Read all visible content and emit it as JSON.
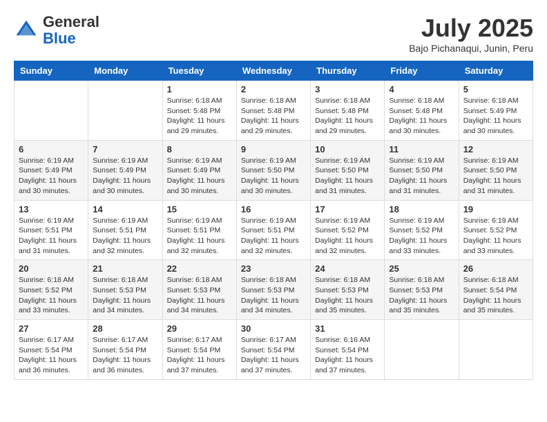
{
  "header": {
    "logo_general": "General",
    "logo_blue": "Blue",
    "month_title": "July 2025",
    "subtitle": "Bajo Pichanaqui, Junin, Peru"
  },
  "weekdays": [
    "Sunday",
    "Monday",
    "Tuesday",
    "Wednesday",
    "Thursday",
    "Friday",
    "Saturday"
  ],
  "weeks": [
    [
      {
        "day": "",
        "info": ""
      },
      {
        "day": "",
        "info": ""
      },
      {
        "day": "1",
        "info": "Sunrise: 6:18 AM\nSunset: 5:48 PM\nDaylight: 11 hours and 29 minutes."
      },
      {
        "day": "2",
        "info": "Sunrise: 6:18 AM\nSunset: 5:48 PM\nDaylight: 11 hours and 29 minutes."
      },
      {
        "day": "3",
        "info": "Sunrise: 6:18 AM\nSunset: 5:48 PM\nDaylight: 11 hours and 29 minutes."
      },
      {
        "day": "4",
        "info": "Sunrise: 6:18 AM\nSunset: 5:48 PM\nDaylight: 11 hours and 30 minutes."
      },
      {
        "day": "5",
        "info": "Sunrise: 6:18 AM\nSunset: 5:49 PM\nDaylight: 11 hours and 30 minutes."
      }
    ],
    [
      {
        "day": "6",
        "info": "Sunrise: 6:19 AM\nSunset: 5:49 PM\nDaylight: 11 hours and 30 minutes."
      },
      {
        "day": "7",
        "info": "Sunrise: 6:19 AM\nSunset: 5:49 PM\nDaylight: 11 hours and 30 minutes."
      },
      {
        "day": "8",
        "info": "Sunrise: 6:19 AM\nSunset: 5:49 PM\nDaylight: 11 hours and 30 minutes."
      },
      {
        "day": "9",
        "info": "Sunrise: 6:19 AM\nSunset: 5:50 PM\nDaylight: 11 hours and 30 minutes."
      },
      {
        "day": "10",
        "info": "Sunrise: 6:19 AM\nSunset: 5:50 PM\nDaylight: 11 hours and 31 minutes."
      },
      {
        "day": "11",
        "info": "Sunrise: 6:19 AM\nSunset: 5:50 PM\nDaylight: 11 hours and 31 minutes."
      },
      {
        "day": "12",
        "info": "Sunrise: 6:19 AM\nSunset: 5:50 PM\nDaylight: 11 hours and 31 minutes."
      }
    ],
    [
      {
        "day": "13",
        "info": "Sunrise: 6:19 AM\nSunset: 5:51 PM\nDaylight: 11 hours and 31 minutes."
      },
      {
        "day": "14",
        "info": "Sunrise: 6:19 AM\nSunset: 5:51 PM\nDaylight: 11 hours and 32 minutes."
      },
      {
        "day": "15",
        "info": "Sunrise: 6:19 AM\nSunset: 5:51 PM\nDaylight: 11 hours and 32 minutes."
      },
      {
        "day": "16",
        "info": "Sunrise: 6:19 AM\nSunset: 5:51 PM\nDaylight: 11 hours and 32 minutes."
      },
      {
        "day": "17",
        "info": "Sunrise: 6:19 AM\nSunset: 5:52 PM\nDaylight: 11 hours and 32 minutes."
      },
      {
        "day": "18",
        "info": "Sunrise: 6:19 AM\nSunset: 5:52 PM\nDaylight: 11 hours and 33 minutes."
      },
      {
        "day": "19",
        "info": "Sunrise: 6:19 AM\nSunset: 5:52 PM\nDaylight: 11 hours and 33 minutes."
      }
    ],
    [
      {
        "day": "20",
        "info": "Sunrise: 6:18 AM\nSunset: 5:52 PM\nDaylight: 11 hours and 33 minutes."
      },
      {
        "day": "21",
        "info": "Sunrise: 6:18 AM\nSunset: 5:53 PM\nDaylight: 11 hours and 34 minutes."
      },
      {
        "day": "22",
        "info": "Sunrise: 6:18 AM\nSunset: 5:53 PM\nDaylight: 11 hours and 34 minutes."
      },
      {
        "day": "23",
        "info": "Sunrise: 6:18 AM\nSunset: 5:53 PM\nDaylight: 11 hours and 34 minutes."
      },
      {
        "day": "24",
        "info": "Sunrise: 6:18 AM\nSunset: 5:53 PM\nDaylight: 11 hours and 35 minutes."
      },
      {
        "day": "25",
        "info": "Sunrise: 6:18 AM\nSunset: 5:53 PM\nDaylight: 11 hours and 35 minutes."
      },
      {
        "day": "26",
        "info": "Sunrise: 6:18 AM\nSunset: 5:54 PM\nDaylight: 11 hours and 35 minutes."
      }
    ],
    [
      {
        "day": "27",
        "info": "Sunrise: 6:17 AM\nSunset: 5:54 PM\nDaylight: 11 hours and 36 minutes."
      },
      {
        "day": "28",
        "info": "Sunrise: 6:17 AM\nSunset: 5:54 PM\nDaylight: 11 hours and 36 minutes."
      },
      {
        "day": "29",
        "info": "Sunrise: 6:17 AM\nSunset: 5:54 PM\nDaylight: 11 hours and 37 minutes."
      },
      {
        "day": "30",
        "info": "Sunrise: 6:17 AM\nSunset: 5:54 PM\nDaylight: 11 hours and 37 minutes."
      },
      {
        "day": "31",
        "info": "Sunrise: 6:16 AM\nSunset: 5:54 PM\nDaylight: 11 hours and 37 minutes."
      },
      {
        "day": "",
        "info": ""
      },
      {
        "day": "",
        "info": ""
      }
    ]
  ]
}
